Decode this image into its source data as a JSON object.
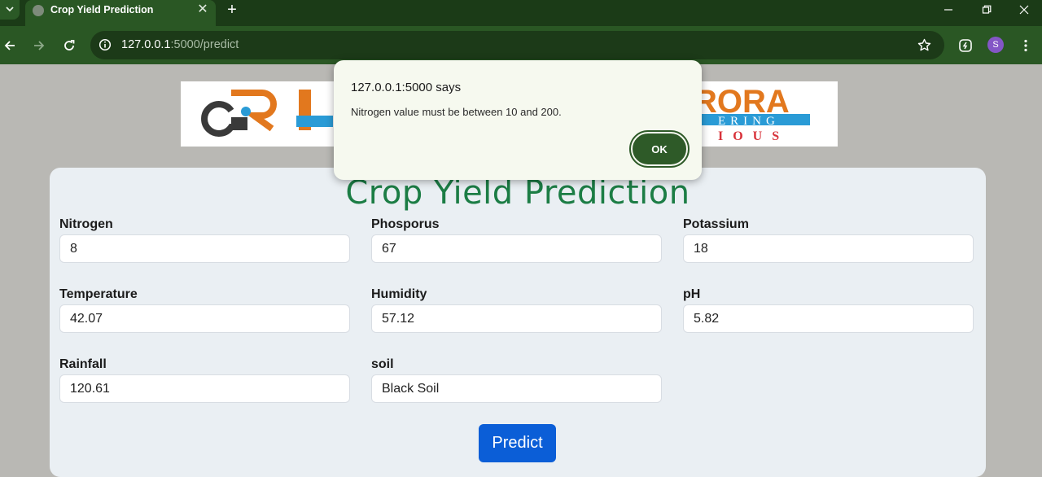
{
  "browser": {
    "tab_title": "Crop Yield Prediction",
    "url_host": "127.0.0.1",
    "url_rest": ":5000/predict",
    "profile_initial": "S"
  },
  "page": {
    "title": "Crop Yield Prediction",
    "fields": [
      {
        "label": "Nitrogen",
        "value": "8"
      },
      {
        "label": "Phosporus",
        "value": "67"
      },
      {
        "label": "Potassium",
        "value": "18"
      },
      {
        "label": "Temperature",
        "value": "42.07"
      },
      {
        "label": "Humidity",
        "value": "57.12"
      },
      {
        "label": "pH",
        "value": "5.82"
      },
      {
        "label": "Rainfall",
        "value": "120.61"
      },
      {
        "label": "soil",
        "value": "Black Soil"
      }
    ],
    "predict_label": "Predict",
    "logo_text": {
      "top": "RORA",
      "middle": "ERING",
      "bottom": "IOUS"
    }
  },
  "dialog": {
    "title": "127.0.0.1:5000 says",
    "message": "Nitrogen value must be between 10 and 200.",
    "ok_label": "OK"
  },
  "colors": {
    "chrome_dark": "#1b3b17",
    "chrome": "#2a5724",
    "title_green": "#1c7d45",
    "button_blue": "#0b5ed7",
    "logo_orange": "#e2781e",
    "logo_blue": "#2a9bd6",
    "logo_red": "#d8323a"
  },
  "icons": [
    "chevron-down-icon",
    "globe-icon",
    "close-icon",
    "plus-icon",
    "minimize-icon",
    "restore-icon",
    "close-window-icon",
    "back-arrow-icon",
    "forward-arrow-icon",
    "reload-icon",
    "site-info-icon",
    "star-icon",
    "extension-icon",
    "more-vert-icon"
  ]
}
